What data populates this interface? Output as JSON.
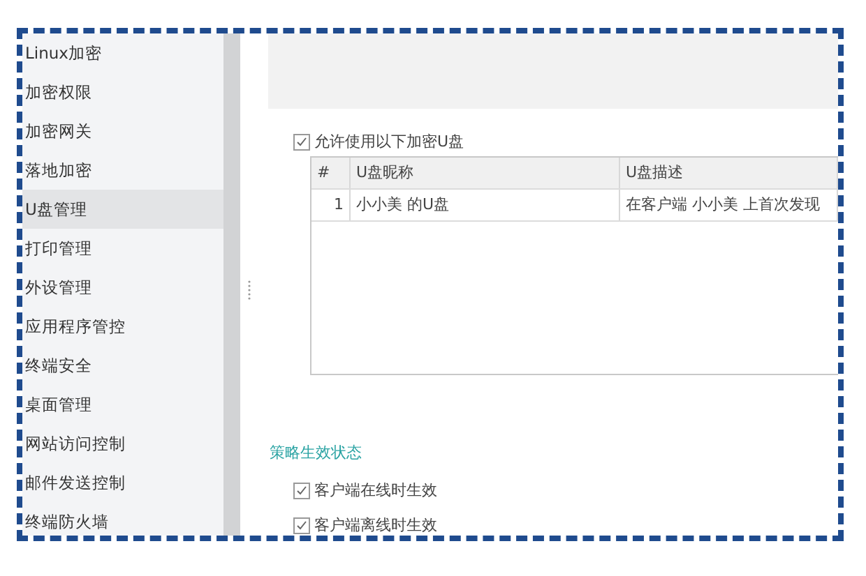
{
  "sidebar": {
    "items": [
      {
        "label": "Linux加密",
        "selected": false
      },
      {
        "label": "加密权限",
        "selected": false
      },
      {
        "label": "加密网关",
        "selected": false
      },
      {
        "label": "落地加密",
        "selected": false
      },
      {
        "label": "U盘管理",
        "selected": true
      },
      {
        "label": "打印管理",
        "selected": false
      },
      {
        "label": "外设管理",
        "selected": false
      },
      {
        "label": "应用程序管控",
        "selected": false
      },
      {
        "label": "终端安全",
        "selected": false
      },
      {
        "label": "桌面管理",
        "selected": false
      },
      {
        "label": "网站访问控制",
        "selected": false
      },
      {
        "label": "邮件发送控制",
        "selected": false
      },
      {
        "label": "终端防火墙",
        "selected": false
      }
    ]
  },
  "allow_checkbox": {
    "label": "允许使用以下加密U盘",
    "checked": true
  },
  "table": {
    "columns": [
      "#",
      "U盘昵称",
      "U盘描述"
    ],
    "rows": [
      {
        "cells": [
          "1",
          "小小美 的U盘",
          "在客户端 小小美 上首次发现"
        ]
      }
    ]
  },
  "status_section": {
    "title": "策略生效状态",
    "options": [
      {
        "label": "客户端在线时生效",
        "checked": true
      },
      {
        "label": "客户端离线时生效",
        "checked": true
      }
    ]
  }
}
